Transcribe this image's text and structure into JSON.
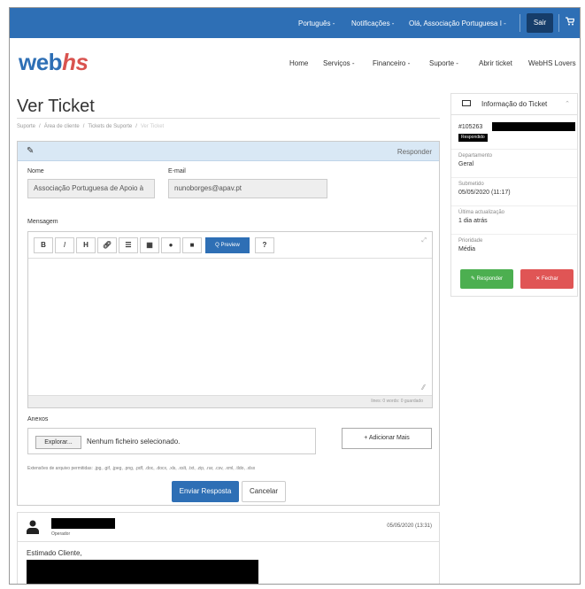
{
  "topbar": {
    "language": "Português -",
    "notifications": "Notificações -",
    "greeting": "Olá, Associação Portuguesa I -",
    "logout": "Sair",
    "cart_icon": "cart-icon"
  },
  "brand": {
    "logo_web": "web",
    "logo_hs": "hs"
  },
  "nav": {
    "home": "Home",
    "services": "Serviços -",
    "finance": "Financeiro -",
    "support": "Suporte -",
    "open_ticket": "Abrir ticket",
    "lovers": "WebHS Lovers"
  },
  "page": {
    "title": "Ver Ticket",
    "breadcrumb": [
      "Suporte",
      "/",
      "Área de cliente",
      "/",
      "Tickets de Suporte",
      "/",
      "Ver Ticket"
    ]
  },
  "reply": {
    "header": "Responder",
    "name_label": "Nome",
    "name_value": "Associação Portuguesa de Apoio à",
    "email_label": "E-mail",
    "email_value": "nunoborges@apav.pt",
    "message_label": "Mensagem",
    "toolbar": {
      "bold": "B",
      "italic": "I",
      "heading": "H",
      "preview": "Q Preview",
      "help": "?"
    },
    "editor_footer": "lines: 0  words: 0  guardado",
    "attachments_label": "Anexos",
    "browse": "Explorar...",
    "no_file": "Nenhum ficheiro selecionado.",
    "add_more": "+ Adicionar Mais",
    "allowed_ext": "Extensões de arquivo permitidas: .jpg, .gif, .jpeg, .png, .pdf, .doc, .docx, .xls, .xslt, .txt, .zip, .rar, .csv, .xml, .tldo, .xlsx",
    "send": "Enviar Resposta",
    "cancel": "Cancelar"
  },
  "message": {
    "role": "Operador",
    "date": "05/05/2020 (13:31)",
    "greeting": "Estimado Cliente,"
  },
  "ticket_info": {
    "title": "Informação do Ticket",
    "ticket_id": "#105263",
    "status": "Respondido",
    "department_label": "Departamento",
    "department": "Geral",
    "submitted_label": "Submetido",
    "submitted": "05/05/2020 (11:17)",
    "last_update_label": "Última actualização",
    "last_update": "1 dia atrás",
    "priority_label": "Prioridade",
    "priority": "Média",
    "reply_btn": "Responder",
    "close_btn": "Fechar",
    "colors": {
      "reply": "#4caf50",
      "close": "#e05555"
    }
  }
}
